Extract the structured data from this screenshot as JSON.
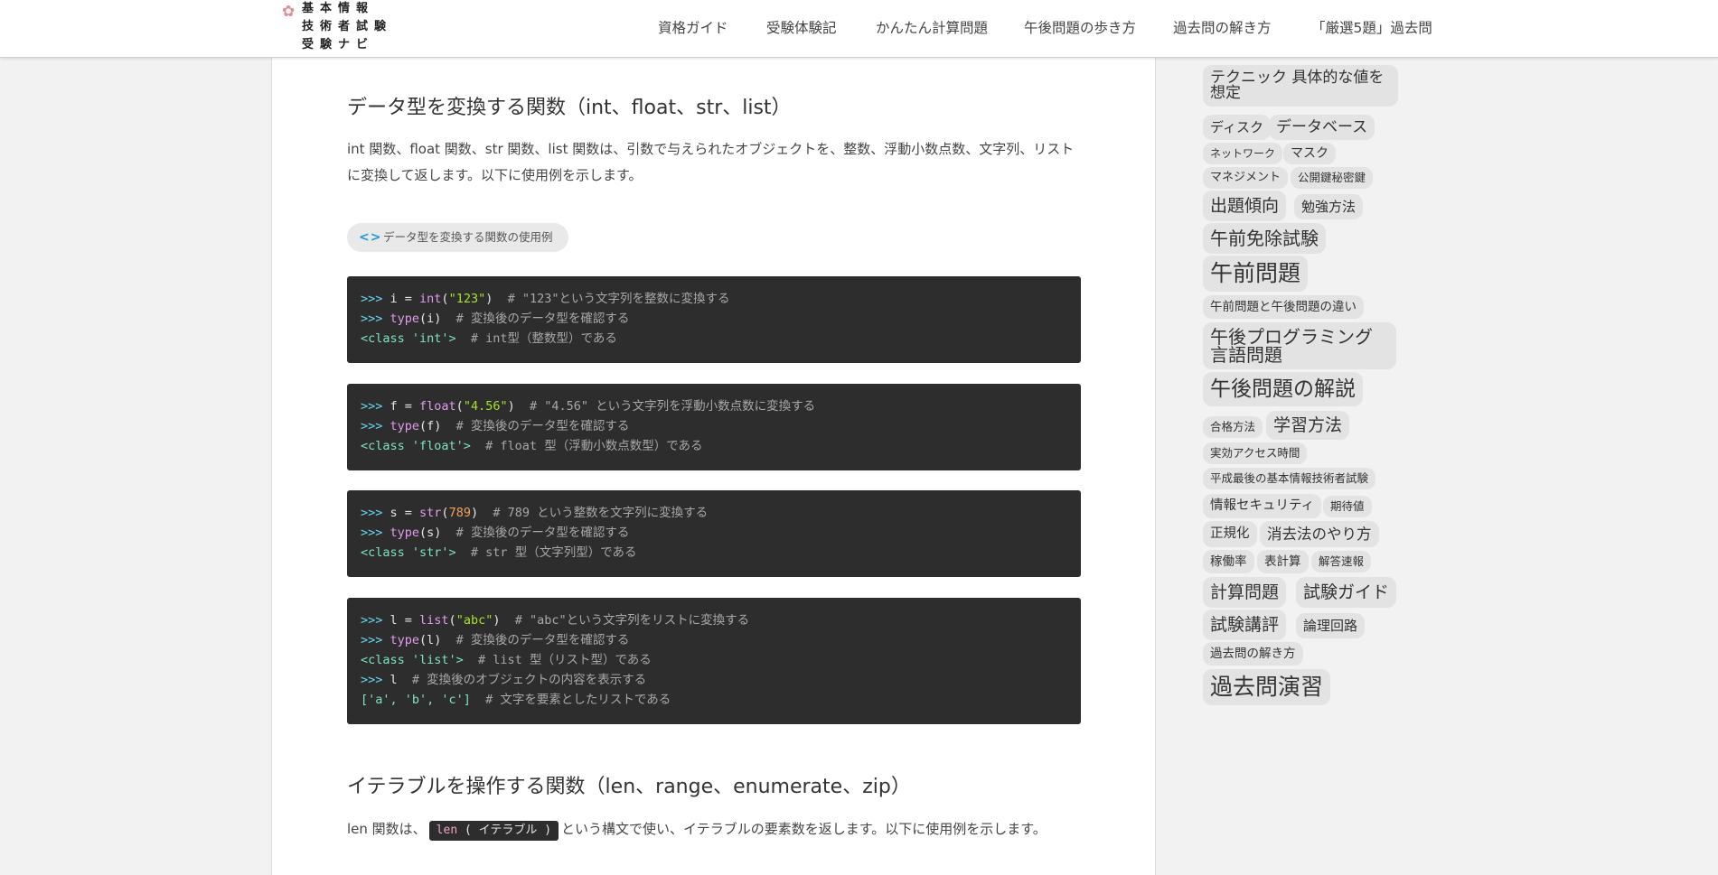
{
  "header": {
    "logo_lines": [
      "基本情報",
      "技術者試験",
      "受験ナビ"
    ],
    "nav": [
      "資格ガイド",
      "受験体験記",
      "かんたん計算問題",
      "午後問題の歩き方",
      "過去問の解き方",
      "「厳選5題」過去問"
    ]
  },
  "article": {
    "section1_heading": "データ型を変換する関数（int、float、str、list）",
    "section1_para": "int 関数、float 関数、str 関数、list 関数は、引数で与えられたオブジェクトを、整数、浮動小数点数、文字列、リストに変換して返します。以下に使用例を示します。",
    "code_label": "データ型を変換する関数の使用例",
    "blocks": [
      [
        [
          {
            "t": ">>> ",
            "c": "p"
          },
          {
            "t": "i = ",
            "c": ""
          },
          {
            "t": "int",
            "c": "f"
          },
          {
            "t": "(",
            "c": ""
          },
          {
            "t": "\"123\"",
            "c": "s"
          },
          {
            "t": ")  ",
            "c": ""
          },
          {
            "t": "# \"123\"という文字列を整数に変換する",
            "c": "c"
          }
        ],
        [
          {
            "t": ">>> ",
            "c": "p"
          },
          {
            "t": "type",
            "c": "f"
          },
          {
            "t": "(i)  ",
            "c": ""
          },
          {
            "t": "# 変換後のデータ型を確認する",
            "c": "c"
          }
        ],
        [
          {
            "t": "<class 'int'>  ",
            "c": "k"
          },
          {
            "t": "# int型（整数型）である",
            "c": "c"
          }
        ]
      ],
      [
        [
          {
            "t": ">>> ",
            "c": "p"
          },
          {
            "t": "f = ",
            "c": ""
          },
          {
            "t": "float",
            "c": "f"
          },
          {
            "t": "(",
            "c": ""
          },
          {
            "t": "\"4.56\"",
            "c": "s"
          },
          {
            "t": ")  ",
            "c": ""
          },
          {
            "t": "# \"4.56\" という文字列を浮動小数点数に変換する",
            "c": "c"
          }
        ],
        [
          {
            "t": ">>> ",
            "c": "p"
          },
          {
            "t": "type",
            "c": "f"
          },
          {
            "t": "(f)  ",
            "c": ""
          },
          {
            "t": "# 変換後のデータ型を確認する",
            "c": "c"
          }
        ],
        [
          {
            "t": "<class 'float'>  ",
            "c": "k"
          },
          {
            "t": "# float 型（浮動小数点数型）である",
            "c": "c"
          }
        ]
      ],
      [
        [
          {
            "t": ">>> ",
            "c": "p"
          },
          {
            "t": "s = ",
            "c": ""
          },
          {
            "t": "str",
            "c": "f"
          },
          {
            "t": "(",
            "c": ""
          },
          {
            "t": "789",
            "c": "n"
          },
          {
            "t": ")  ",
            "c": ""
          },
          {
            "t": "# 789 という整数を文字列に変換する",
            "c": "c"
          }
        ],
        [
          {
            "t": ">>> ",
            "c": "p"
          },
          {
            "t": "type",
            "c": "f"
          },
          {
            "t": "(s)  ",
            "c": ""
          },
          {
            "t": "# 変換後のデータ型を確認する",
            "c": "c"
          }
        ],
        [
          {
            "t": "<class 'str'>  ",
            "c": "k"
          },
          {
            "t": "# str 型（文字列型）である",
            "c": "c"
          }
        ]
      ],
      [
        [
          {
            "t": ">>> ",
            "c": "p"
          },
          {
            "t": "l = ",
            "c": ""
          },
          {
            "t": "list",
            "c": "f"
          },
          {
            "t": "(",
            "c": ""
          },
          {
            "t": "\"abc\"",
            "c": "s"
          },
          {
            "t": ")  ",
            "c": ""
          },
          {
            "t": "# \"abc\"という文字列をリストに変換する",
            "c": "c"
          }
        ],
        [
          {
            "t": ">>> ",
            "c": "p"
          },
          {
            "t": "type",
            "c": "f"
          },
          {
            "t": "(l)  ",
            "c": ""
          },
          {
            "t": "# 変換後のデータ型を確認する",
            "c": "c"
          }
        ],
        [
          {
            "t": "<class 'list'>  ",
            "c": "k"
          },
          {
            "t": "# list 型（リスト型）である",
            "c": "c"
          }
        ],
        [
          {
            "t": ">>> ",
            "c": "p"
          },
          {
            "t": "l  ",
            "c": ""
          },
          {
            "t": "# 変換後のオブジェクトの内容を表示する",
            "c": "c"
          }
        ],
        [
          {
            "t": "['a', 'b', 'c']  ",
            "c": "k"
          },
          {
            "t": "# 文字を要素としたリストである",
            "c": "c"
          }
        ]
      ]
    ],
    "section2_heading": "イテラブルを操作する関数（len、range、enumerate、zip）",
    "section2_para_before": "len 関数は、",
    "inline_code_func": "len",
    "inline_code_args": " ( イテラブル )",
    "section2_para_after": "という構文で使い、イテラブルの要素数を返します。以下に使用例を示します。"
  },
  "tags": [
    "テクニック 具体的な値を想定",
    "ディスク",
    "データベース",
    "ネットワーク",
    "マスク",
    "マネジメント",
    "公開鍵秘密鍵",
    "出題傾向",
    "勉強方法",
    "午前免除試験",
    "午前問題",
    "午前問題と午後問題の違い",
    "午後プログラミング言語問題",
    "午後問題の解説",
    "合格方法",
    "学習方法",
    "実効アクセス時間",
    "平成最後の基本情報技術者試験",
    "情報セキュリティ",
    "期待値",
    "正規化",
    "消去法のやり方",
    "稼働率",
    "表計算",
    "解答速報",
    "計算問題",
    "試験ガイド",
    "試験講評",
    "論理回路",
    "過去問の解き方",
    "過去問演習"
  ]
}
